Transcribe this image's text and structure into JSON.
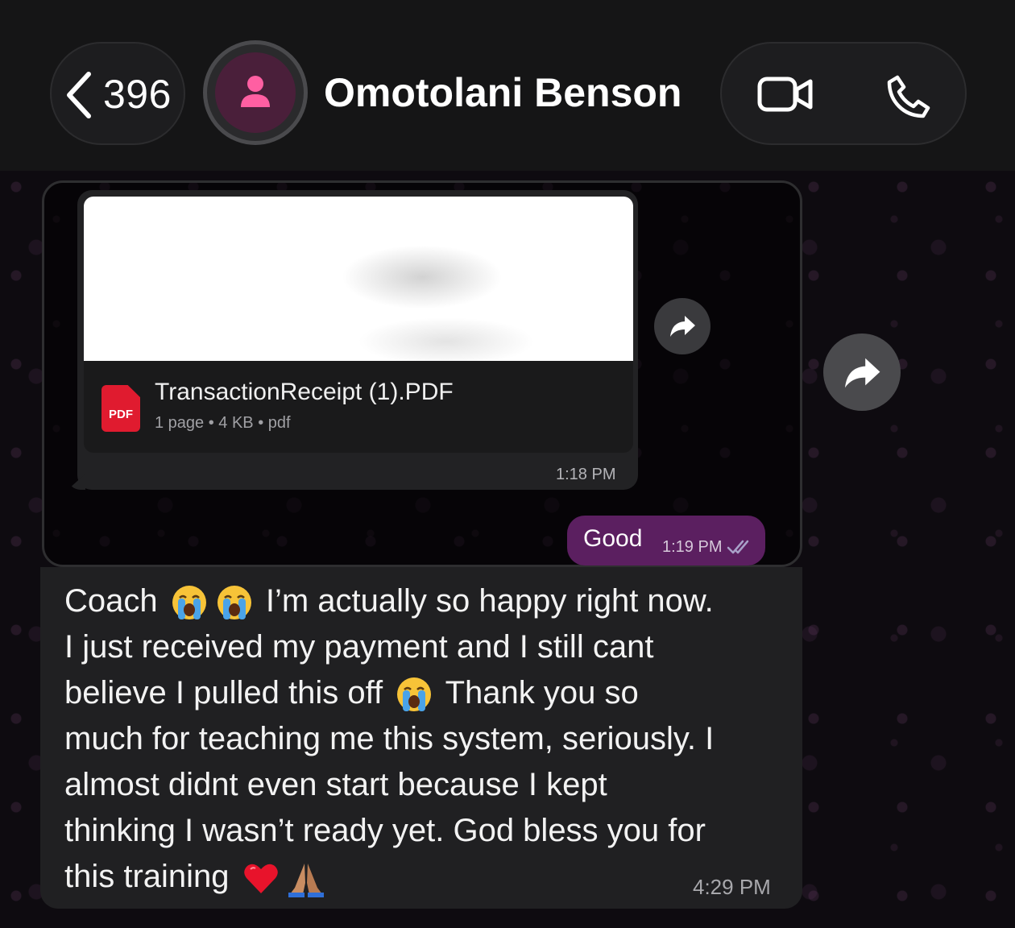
{
  "header": {
    "back_count": "396",
    "contact_name": "Omotolani Benson",
    "icons": [
      "chevron-left-icon",
      "person-icon",
      "video-call-icon",
      "phone-icon"
    ]
  },
  "messages": {
    "pdf": {
      "filename": "TransactionReceipt (1).PDF",
      "icon_label": "PDF",
      "meta": "1 page • 4 KB • pdf",
      "time": "1:18 PM"
    },
    "outgoing": {
      "text": "Good",
      "time": "1:19 PM",
      "status_icon": "double-check-icon"
    },
    "incoming": {
      "lines": [
        {
          "parts": [
            "Coach ",
            "loudly-crying-emoji",
            "loudly-crying-emoji",
            " I’m actually so happy right now."
          ]
        },
        {
          "parts": [
            "I just received my payment and I still cant"
          ]
        },
        {
          "parts": [
            "believe I pulled this off ",
            "loudly-crying-emoji",
            " Thank you so"
          ]
        },
        {
          "parts": [
            "much for teaching me this system, seriously. I"
          ]
        },
        {
          "parts": [
            "almost didnt even start because I kept"
          ]
        },
        {
          "parts": [
            "thinking I wasn’t ready yet. God bless you for"
          ]
        },
        {
          "parts": [
            "this training ",
            "red-heart-emoji",
            "folded-hands-emoji"
          ]
        }
      ],
      "time": "4:29 PM"
    }
  },
  "colors": {
    "header_bg": "#151516",
    "chat_bg": "#0e0b10",
    "incoming_bubble": "#222224",
    "outgoing_bubble": "#5b1f60",
    "pdf_red": "#e01b2f",
    "avatar_bg": "#4a1f3a",
    "avatar_person": "#ff5fa2"
  }
}
